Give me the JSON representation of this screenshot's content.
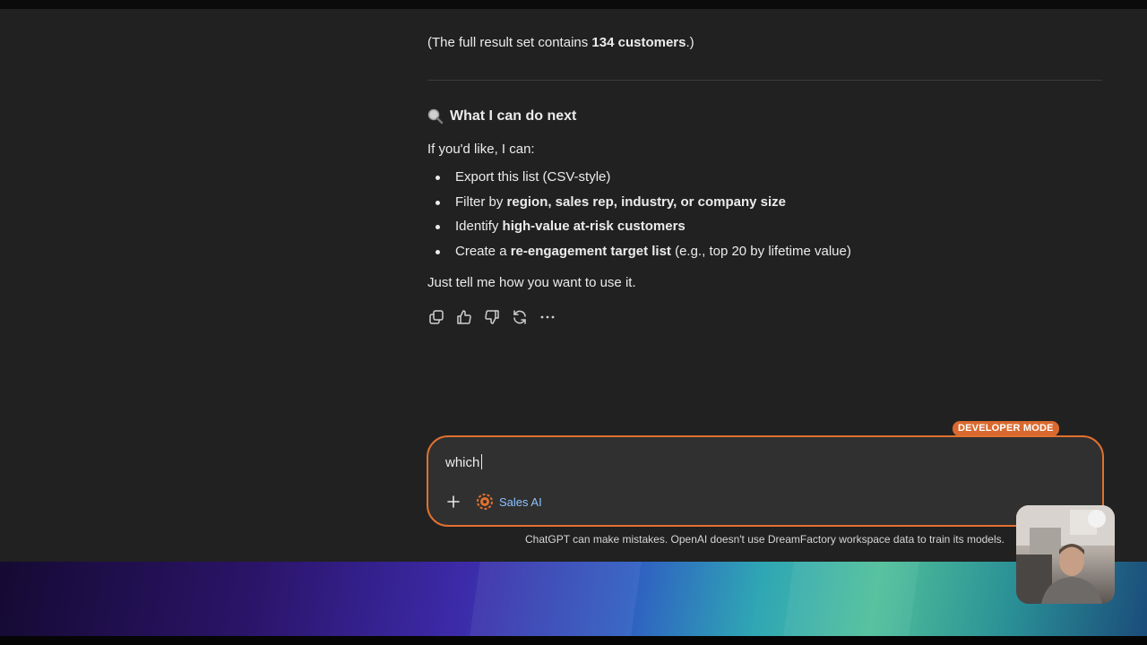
{
  "response": {
    "result_note_prefix": "(The full result set contains ",
    "result_note_bold": "134 customers",
    "result_note_suffix": ".)",
    "section_title": "What I can do next",
    "intro": "If you'd like, I can:",
    "bullets": [
      {
        "pre": "Export this list (CSV-style)",
        "bold": "",
        "post": ""
      },
      {
        "pre": "Filter by ",
        "bold": "region, sales rep, industry, or company size",
        "post": ""
      },
      {
        "pre": "Identify ",
        "bold": "high-value at-risk customers",
        "post": ""
      },
      {
        "pre": "Create a ",
        "bold": "re-engagement target list",
        "post": " (e.g., top 20 by lifetime value)"
      }
    ],
    "outro": "Just tell me how you want to use it.",
    "actions": [
      "copy-icon",
      "thumbs-up-icon",
      "thumbs-down-icon",
      "regenerate-icon",
      "more-icon"
    ]
  },
  "composer": {
    "badge": "DEVELOPER MODE",
    "input_value": "which",
    "tool_label": "Sales AI",
    "tool_icon": "gear-icon",
    "accent_color": "#e0712f"
  },
  "disclaimer": "ChatGPT can make mistakes. OpenAI doesn't use DreamFactory workspace data to train its models."
}
